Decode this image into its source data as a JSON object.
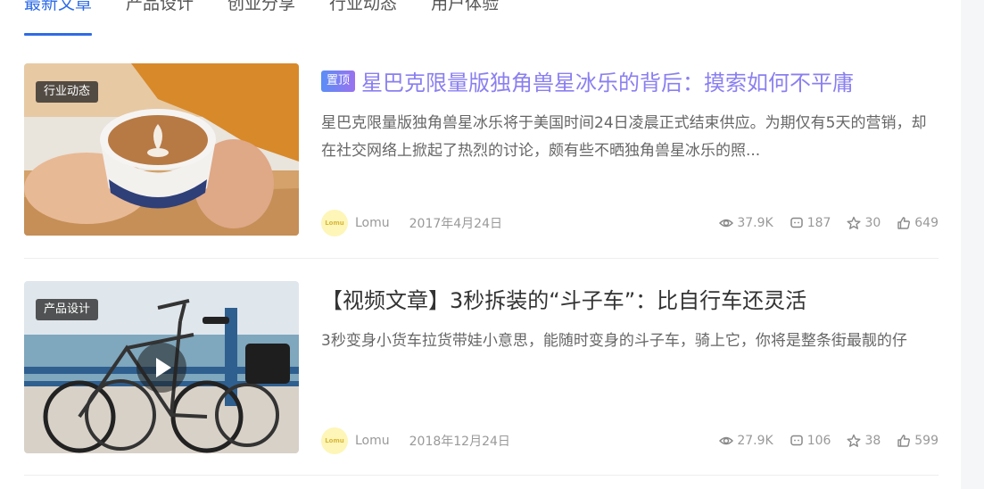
{
  "tabs": [
    "最新文章",
    "产品设计",
    "创业分享",
    "行业动态",
    "用户体验"
  ],
  "articles": [
    {
      "category": "行业动态",
      "pinned_label": "置顶",
      "title": "星巴克限量版独角兽星冰乐的背后：摸索如何不平庸",
      "excerpt": "星巴克限量版独角兽星冰乐将于美国时间24日凌晨正式结束供应。为期仅有5天的营销，却在社交网络上掀起了热烈的讨论，颇有些不晒独角兽星冰乐的照...",
      "avatar_text": "Lomu",
      "author": "Lomu",
      "date": "2017年4月24日",
      "views": "37.9K",
      "comments": "187",
      "favorites": "30",
      "likes": "649"
    },
    {
      "category": "产品设计",
      "title": "【视频文章】3秒拆装的“斗子车”：比自行车还灵活",
      "excerpt": "3秒变身小货车拉货带娃小意思，能随时变身的斗子车，骑上它，你将是整条街最靓的仔",
      "avatar_text": "Lomu",
      "author": "Lomu",
      "date": "2018年12月24日",
      "views": "27.9K",
      "comments": "106",
      "favorites": "38",
      "likes": "599"
    }
  ],
  "colors": {
    "accent": "#2e6be6",
    "pinned_title": "#8a7ff0"
  },
  "icons": [
    "eye-icon",
    "comment-icon",
    "star-icon",
    "thumbs-up-icon",
    "play-icon"
  ]
}
